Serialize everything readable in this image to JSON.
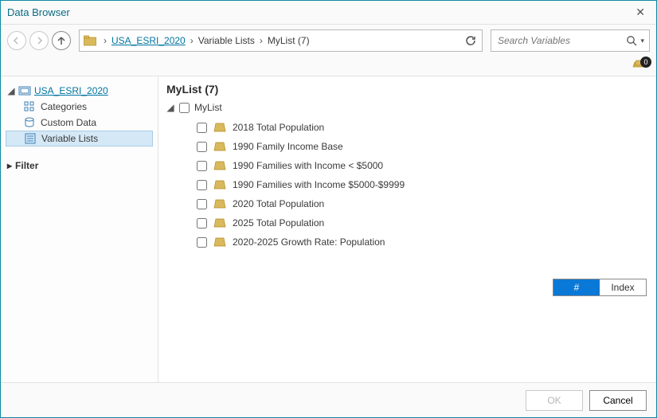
{
  "title": "Data Browser",
  "breadcrumb": {
    "root": "USA_ESRI_2020",
    "seg1": "Variable Lists",
    "seg2": "MyList (7)"
  },
  "search": {
    "placeholder": "Search Variables"
  },
  "badge_count": "0",
  "sidebar": {
    "root": "USA_ESRI_2020",
    "items": [
      {
        "label": "Categories"
      },
      {
        "label": "Custom Data"
      },
      {
        "label": "Variable Lists"
      }
    ],
    "filter_label": "Filter"
  },
  "main": {
    "heading": "MyList (7)",
    "list_name": "MyList",
    "variables": [
      {
        "label": "2018 Total Population"
      },
      {
        "label": "1990 Family Income Base"
      },
      {
        "label": "1990 Families with Income < $5000"
      },
      {
        "label": "1990 Families with Income $5000-$9999"
      },
      {
        "label": "2020 Total Population"
      },
      {
        "label": "2025 Total Population"
      },
      {
        "label": "2020-2025 Growth Rate: Population"
      }
    ],
    "toggle": {
      "hash": "#",
      "index": "Index"
    }
  },
  "footer": {
    "ok": "OK",
    "cancel": "Cancel"
  }
}
